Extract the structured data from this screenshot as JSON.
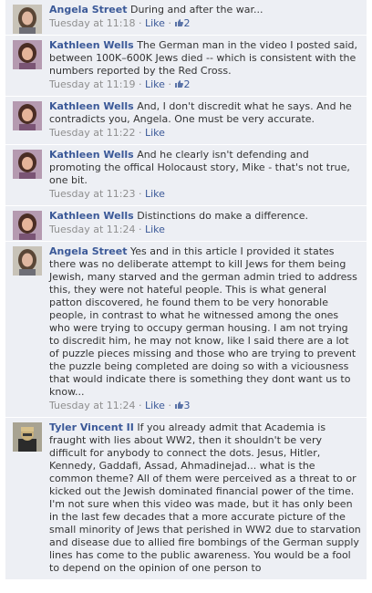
{
  "ui": {
    "separator": "·",
    "like_label": "Like"
  },
  "comments": [
    {
      "author": "Angela Street",
      "text": "During and after the war...",
      "time": "Tuesday at 11:18",
      "likes": "2",
      "avatar": "angela-avatar"
    },
    {
      "author": "Kathleen Wells",
      "text": "The German man in the video I posted said, between 100K–600K Jews died -- which is consistent with the numbers reported by the Red Cross.",
      "time": "Tuesday at 11:19",
      "likes": "2",
      "avatar": "kathleen-avatar"
    },
    {
      "author": "Kathleen Wells",
      "text": "And, I don't discredit what he says. And he contradicts you, Angela. One must be very accurate.",
      "time": "Tuesday at 11:22",
      "likes": "",
      "avatar": "kathleen-avatar"
    },
    {
      "author": "Kathleen Wells",
      "text": "And he clearly isn't defending and promoting the offical Holocaust story, Mike - that's not true, one bit.",
      "time": "Tuesday at 11:23",
      "likes": "",
      "avatar": "kathleen-avatar"
    },
    {
      "author": "Kathleen Wells",
      "text": "Distinctions do make a difference.",
      "time": "Tuesday at 11:24",
      "likes": "",
      "avatar": "kathleen-avatar"
    },
    {
      "author": "Angela Street",
      "text": "Yes and in this article I provided it states there was no deliberate attempt to kill Jews for them being Jewish, many starved and the german admin tried to address this, they were not hateful people. This is what general patton discovered, he found them to be very honorable people, in contrast to what he witnessed among the ones who were trying to occupy german housing. I am not trying to discredit him, he may not know, like I said there are a lot of puzzle pieces missing and those who are trying to prevent the puzzle being completed are doing so with a viciousness that would indicate there is something they dont want us to know...",
      "time": "Tuesday at 11:24",
      "likes": "3",
      "avatar": "angela-avatar"
    },
    {
      "author": "Tyler Vincent II",
      "text": "If you already admit that Academia is fraught with lies about WW2, then it shouldn't be very difficult for anybody to connect the dots. Jesus, Hitler, Kennedy, Gaddafi, Assad, Ahmadinejad... what is the common theme? All of them were perceived as a threat to or kicked out the Jewish dominated financial power of the time. I'm not sure when this video was made, but it has only been in the last few decades that a more accurate picture of the small minority of Jews that perished in WW2 due to starvation and disease due to allied fire bombings of the German supply lines has come to the public awareness. You would be a fool to depend on the opinion of one person to",
      "time": "",
      "likes": "",
      "avatar": "tyler-avatar"
    }
  ]
}
